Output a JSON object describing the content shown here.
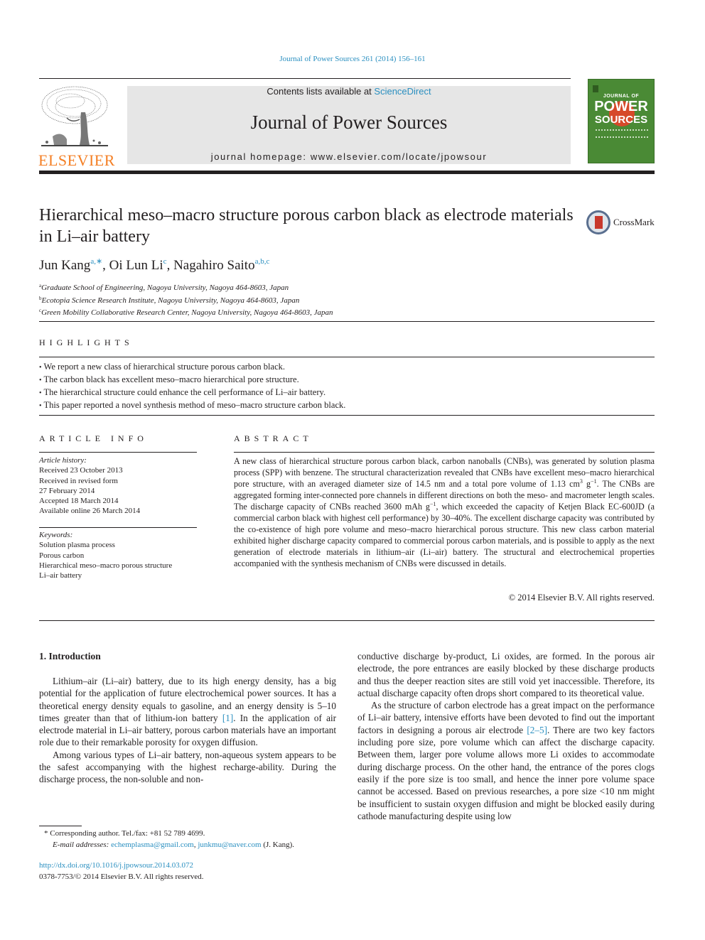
{
  "header": {
    "journal_ref": "Journal of Power Sources 261 (2014) 156–161",
    "contents_prefix": "Contents lists available at ",
    "contents_link": "ScienceDirect",
    "journal_title": "Journal of Power Sources",
    "homepage": "journal homepage: www.elsevier.com/locate/jpowsour",
    "publisher_logo": "ELSEVIER",
    "cover": {
      "top_text": "JOURNAL OF",
      "power": "POWER",
      "sources": "SOURCES",
      "bg_color": "#4a8a35",
      "sun_color": "#d6492a"
    }
  },
  "article": {
    "title": "Hierarchical meso–macro structure porous carbon black as electrode materials in Li–air battery",
    "crossmark_label": "CrossMark",
    "authors": [
      {
        "name": "Jun Kang",
        "sup": "a,∗"
      },
      {
        "name": "Oi Lun Li",
        "sup": "c"
      },
      {
        "name": "Nagahiro Saito",
        "sup": "a,b,c"
      }
    ],
    "affiliations": [
      {
        "sup": "a",
        "text": "Graduate School of Engineering, Nagoya University, Nagoya 464-8603, Japan"
      },
      {
        "sup": "b",
        "text": "Ecotopia Science Research Institute, Nagoya University, Nagoya 464-8603, Japan"
      },
      {
        "sup": "c",
        "text": "Green Mobility Collaborative Research Center, Nagoya University, Nagoya 464-8603, Japan"
      }
    ]
  },
  "highlights": {
    "heading": "HIGHLIGHTS",
    "items": [
      "We report a new class of hierarchical structure porous carbon black.",
      "The carbon black has excellent meso–macro hierarchical pore structure.",
      "The hierarchical structure could enhance the cell performance of Li–air battery.",
      "This paper reported a novel synthesis method of meso–macro structure carbon black."
    ]
  },
  "article_info": {
    "heading": "ARTICLE INFO",
    "history_label": "Article history:",
    "history": [
      "Received 23 October 2013",
      "Received in revised form",
      "27 February 2014",
      "Accepted 18 March 2014",
      "Available online 26 March 2014"
    ],
    "keywords_label": "Keywords:",
    "keywords": [
      "Solution plasma process",
      "Porous carbon",
      "Hierarchical meso–macro porous structure",
      "Li–air battery"
    ]
  },
  "abstract": {
    "heading": "ABSTRACT",
    "part1": "A new class of hierarchical structure porous carbon black, carbon nanoballs (CNBs), was generated by solution plasma process (SPP) with benzene. The structural characterization revealed that CNBs have excellent meso–macro hierarchical pore structure, with an averaged diameter size of 14.5 nm and a total pore volume of 1.13 cm",
    "sup1": "3",
    "part2": " g",
    "sup2": "−1",
    "part3": ". The CNBs are aggregated forming inter-connected pore channels in different directions on both the meso- and macrometer length scales. The discharge capacity of CNBs reached 3600 mAh g",
    "sup3": "−1",
    "part4": ", which exceeded the capacity of Ketjen Black EC-600JD (a commercial carbon black with highest cell performance) by 30–40%. The excellent discharge capacity was contributed by the co-existence of high pore volume and meso–macro hierarchical porous structure. This new class carbon material exhibited higher discharge capacity compared to commercial porous carbon materials, and is possible to apply as the next generation of electrode materials in lithium–air (Li–air) battery. The structural and electrochemical properties accompanied with the synthesis mechanism of CNBs were discussed in details.",
    "copyright": "© 2014 Elsevier B.V. All rights reserved."
  },
  "body": {
    "section_heading": "1.  Introduction",
    "left_p1_a": "Lithium–air (Li–air) battery, due to its high energy density, has a big potential for the application of future electrochemical power sources. It has a theoretical energy density equals to gasoline, and an energy density is 5–10 times greater than that of lithium-ion battery ",
    "left_p1_ref": "[1]",
    "left_p1_b": ". In the application of air electrode material in Li–air battery, porous carbon materials have an important role due to their remarkable porosity for oxygen diffusion.",
    "left_p2": "Among various types of Li–air battery, non-aqueous system appears to be the safest accompanying with the highest recharge-ability. During the discharge process, the non-soluble and non-",
    "right_p1": "conductive discharge by-product, Li oxides, are formed. In the porous air electrode, the pore entrances are easily blocked by these discharge products and thus the deeper reaction sites are still void yet inaccessible. Therefore, its actual discharge capacity often drops short compared to its theoretical value.",
    "right_p2_a": "As the structure of carbon electrode has a great impact on the performance of Li–air battery, intensive efforts have been devoted to find out the important factors in designing a porous air electrode ",
    "right_p2_ref": "[2–5]",
    "right_p2_b": ". There are two key factors including pore size, pore volume which can affect the discharge capacity. Between them, larger pore volume allows more Li oxides to accommodate during discharge process. On the other hand, the entrance of the pores clogs easily if the pore size is too small, and hence the inner pore volume space cannot be accessed. Based on previous researches, a pore size <10 nm might be insufficient to sustain oxygen diffusion and might be blocked easily during cathode manufacturing despite using low"
  },
  "footnote": {
    "star": "*",
    "corresponding": " Corresponding author. Tel./fax: +81 52 789 4699.",
    "email_label": "E-mail addresses:",
    "email1": "echemplasma@gmail.com",
    "sep": ", ",
    "email2": "junkmu@naver.com",
    "email_suffix": " (J. Kang)."
  },
  "footer": {
    "doi": "http://dx.doi.org/10.1016/j.jpowsour.2014.03.072",
    "issn_copyright": "0378-7753/© 2014 Elsevier B.V. All rights reserved."
  },
  "colors": {
    "link": "#2a8fc0",
    "elsevier_orange": "#f47f24",
    "masthead_bg": "#e6e6e6"
  }
}
